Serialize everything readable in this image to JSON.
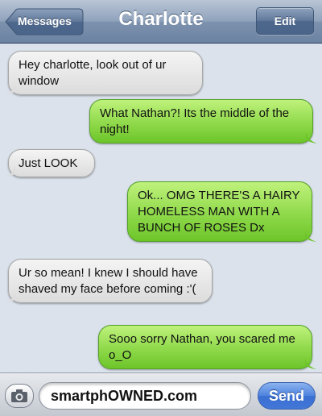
{
  "header": {
    "back_label": "Messages",
    "title": "Charlotte",
    "edit_label": "Edit"
  },
  "messages": [
    {
      "side": "in",
      "text": "Hey charlotte, look out of ur window"
    },
    {
      "side": "out",
      "text": "What Nathan?! Its the middle of the night!"
    },
    {
      "side": "in",
      "text": "Just LOOK"
    },
    {
      "side": "out",
      "text": "Ok... OMG THERE'S A HAIRY HOMELESS MAN WITH A BUNCH OF ROSES Dx"
    },
    {
      "side": "in",
      "text": "Ur so mean! I knew I should have shaved my face before coming :'("
    },
    {
      "side": "out",
      "text": "Sooo sorry Nathan, you scared me o_O"
    }
  ],
  "composer": {
    "input_value": "smartphOWNED.com",
    "send_label": "Send",
    "camera_icon": "camera-icon"
  },
  "colors": {
    "incoming_bubble": "#e4e4e4",
    "outgoing_bubble": "#8fd94a",
    "nav_bar": "#7d92ae",
    "send_button": "#4277d7"
  }
}
